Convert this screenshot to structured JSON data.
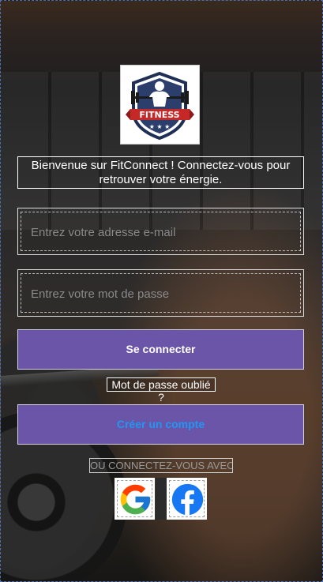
{
  "logo": {
    "text": "FITNESS",
    "icon": "fitness-weightlifter-shield-logo"
  },
  "welcome": {
    "message": "Bienvenue sur FitConnect ! Connectez-vous pour retrouver votre énergie."
  },
  "email": {
    "placeholder": "Entrez votre adresse e-mail",
    "value": ""
  },
  "password": {
    "placeholder": "Entrez votre mot de passe",
    "value": ""
  },
  "login_button": {
    "label": "Se connecter",
    "text_color": "#ffffff",
    "bg_color": "#6a55a8"
  },
  "forgot_password": {
    "label": "Mot de passe oublié ?"
  },
  "create_account_button": {
    "label": "Créer un compte",
    "text_color": "#2196f3",
    "bg_color": "#6a55a8"
  },
  "social": {
    "separator_text": "OU CONNECTEZ-VOUS AVEC",
    "providers": [
      {
        "name": "Google",
        "icon": "google-icon"
      },
      {
        "name": "Facebook",
        "icon": "facebook-icon"
      }
    ]
  }
}
